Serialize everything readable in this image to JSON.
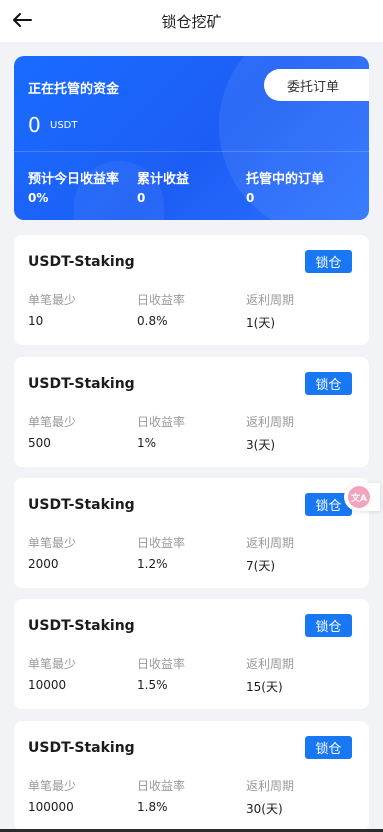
{
  "header": {
    "title": "锁仓挖矿",
    "back_icon": "arrow-left-icon"
  },
  "summary": {
    "managed_funds_label": "正在托管的资金",
    "amount": "0",
    "unit": "USDT",
    "delegate_orders_button": "委托订单",
    "stats": [
      {
        "label": "预计今日收益率",
        "value": "0%"
      },
      {
        "label": "累计收益",
        "value": "0"
      },
      {
        "label": "托管中的订单",
        "value": "0"
      }
    ]
  },
  "column_labels": {
    "min_per_order": "单笔最少",
    "daily_yield": "日收益率",
    "payout_period": "返利周期"
  },
  "products": [
    {
      "name": "USDT-Staking",
      "button": "锁仓",
      "min": "10",
      "rate": "0.8%",
      "period": "1(天)"
    },
    {
      "name": "USDT-Staking",
      "button": "锁仓",
      "min": "500",
      "rate": "1%",
      "period": "3(天)"
    },
    {
      "name": "USDT-Staking",
      "button": "锁仓",
      "min": "2000",
      "rate": "1.2%",
      "period": "7(天)"
    },
    {
      "name": "USDT-Staking",
      "button": "锁仓",
      "min": "10000",
      "rate": "1.5%",
      "period": "15(天)"
    },
    {
      "name": "USDT-Staking",
      "button": "锁仓",
      "min": "100000",
      "rate": "1.8%",
      "period": "30(天)"
    }
  ],
  "floating_widget": {
    "icon": "translate-icon",
    "text": "文A"
  },
  "colors": {
    "accent": "#1a6bff",
    "button": "#1877f2",
    "background": "#f2f3f7"
  }
}
